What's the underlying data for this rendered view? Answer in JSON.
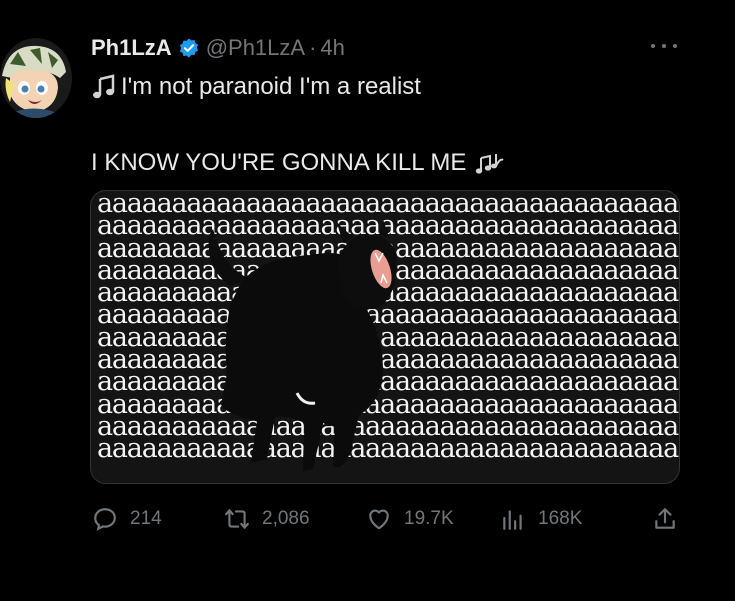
{
  "tweet": {
    "display_name": "Ph1LzA",
    "handle": "@Ph1LzA",
    "separator": "·",
    "time": "4h",
    "line1": "I'm not paranoid I'm a realist",
    "line2": "I KNOW YOU'RE GONNA KILL ME",
    "line1_emoji": "musical-note-icon",
    "line2_emoji": "musical-notes-icon"
  },
  "media": {
    "fill_char": "a",
    "rows": 12
  },
  "actions": {
    "replies": "214",
    "retweets": "2,086",
    "likes": "19.7K",
    "views": "168K"
  },
  "colors": {
    "background": "#000000",
    "text": "#e7e9ea",
    "muted": "#71767b",
    "verified": "#1d9bf0"
  }
}
